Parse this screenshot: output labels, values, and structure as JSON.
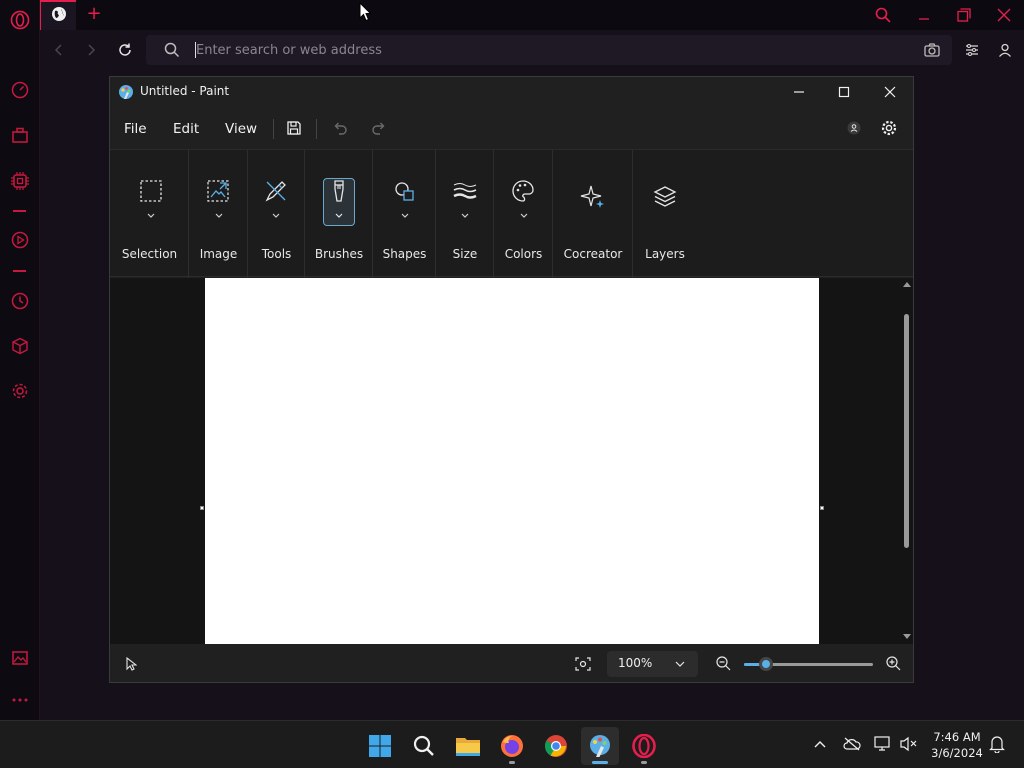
{
  "browser": {
    "address_placeholder": "Enter search or web address",
    "accent_color": "#e61e4d",
    "sidebar_icons": [
      "opera-logo-icon",
      "speed-dial-icon",
      "briefcase-icon",
      "ai-chip-icon",
      "player-icon",
      "history-icon",
      "cube-icon",
      "settings-icon",
      "gallery-icon",
      "more-icon"
    ]
  },
  "paint": {
    "title": "Untitled - Paint",
    "menu": {
      "file": "File",
      "edit": "Edit",
      "view": "View"
    },
    "ribbon": {
      "selection": "Selection",
      "image": "Image",
      "tools": "Tools",
      "brushes": "Brushes",
      "shapes": "Shapes",
      "size": "Size",
      "colors": "Colors",
      "cocreator": "Cocreator",
      "layers": "Layers"
    },
    "zoom_level": "100%",
    "zoom_slider_fraction": 0.17
  },
  "taskbar": {
    "time": "7:46 AM",
    "date": "3/6/2024",
    "apps": [
      "windows-start-icon",
      "search-icon",
      "file-explorer-icon",
      "firefox-icon",
      "chrome-icon",
      "paint-icon",
      "opera-icon"
    ]
  }
}
